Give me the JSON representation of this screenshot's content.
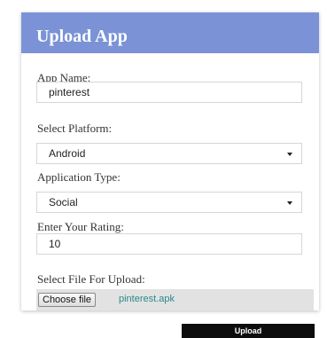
{
  "header": {
    "title": "Upload App",
    "color": "#7b93d6"
  },
  "fields": {
    "app_name": {
      "label": "App Name:",
      "value": "pinterest"
    },
    "platform": {
      "label": "Select Platform:",
      "value": "Android"
    },
    "app_type": {
      "label": "Application Type:",
      "value": "Social"
    },
    "rating": {
      "label": "Enter Your Rating:",
      "value": "10"
    },
    "file": {
      "label": "Select File For Upload:",
      "button_label": "Choose file",
      "file_name": "pinterest.apk"
    }
  },
  "actions": {
    "upload_label": "Upload"
  },
  "icons": {
    "select_caret": "caret-down-icon"
  }
}
